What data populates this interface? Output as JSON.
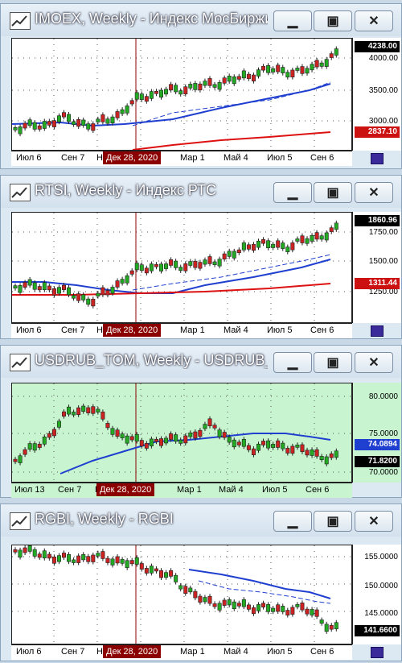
{
  "windows": [
    {
      "id": "imoex",
      "title": "IMOEX, Weekly - Индекс МосБиржи",
      "background": "#ffffff",
      "last_price": "4238.00",
      "ma_tag": "2837.10",
      "y_ticks": [
        "4000.00",
        "3500.00",
        "3000.00"
      ],
      "x_labels": [
        "Июл 6",
        "Сен 7",
        "Н",
        "Дек 28, 2020",
        "Мар 1",
        "Май 4",
        "Июл 5",
        "Сен 6"
      ]
    },
    {
      "id": "rtsi",
      "title": "RTSI, Weekly - Индекс РТС",
      "background": "#ffffff",
      "last_price": "1860.96",
      "ma_tag": "1311.44",
      "y_ticks": [
        "1750.00",
        "1500.00",
        "1250.00"
      ],
      "x_labels": [
        "Июл 6",
        "Сен 7",
        "Н",
        "Дек 28, 2020",
        "Мар 1",
        "Май 4",
        "Июл 5",
        "Сен 6"
      ]
    },
    {
      "id": "usdrub",
      "title": "USDRUB_TOM, Weekly - USDRUB_T...",
      "background": "#c8f5d0",
      "last_price": "71.8200",
      "ma_tag": "74.0894",
      "y_ticks": [
        "80.0000",
        "75.0000",
        "70.0000"
      ],
      "x_labels": [
        "Июл 13",
        "Сен 7",
        "Н",
        "Дек 28, 2020",
        "Мар 1",
        "Май 4",
        "Июл 5",
        "Сен 6"
      ]
    },
    {
      "id": "rgbi",
      "title": "RGBI, Weekly - RGBI",
      "background": "#ffffff",
      "last_price": "141.6600",
      "ma_tag": "",
      "y_ticks": [
        "155.0000",
        "150.0000",
        "145.0000"
      ],
      "x_labels": [
        "Июл 6",
        "Сен 7",
        "Н",
        "Дек 28, 2020",
        "Мар 1",
        "Май 4",
        "Июл 5",
        "Сен 6"
      ]
    }
  ],
  "colors": {
    "up": "#22aa22",
    "down": "#cc2222",
    "ma_fast": "#1f3fd0",
    "ma_slow": "#dd1111",
    "cursor": "#8b0000",
    "tag_black": "#000000",
    "tag_red": "#cc1111",
    "tag_blue": "#1f3fd0"
  },
  "icons": {
    "minimize": "minimize-icon",
    "maximize": "maximize-icon",
    "close": "close-icon",
    "app": "chart-app-icon"
  }
}
